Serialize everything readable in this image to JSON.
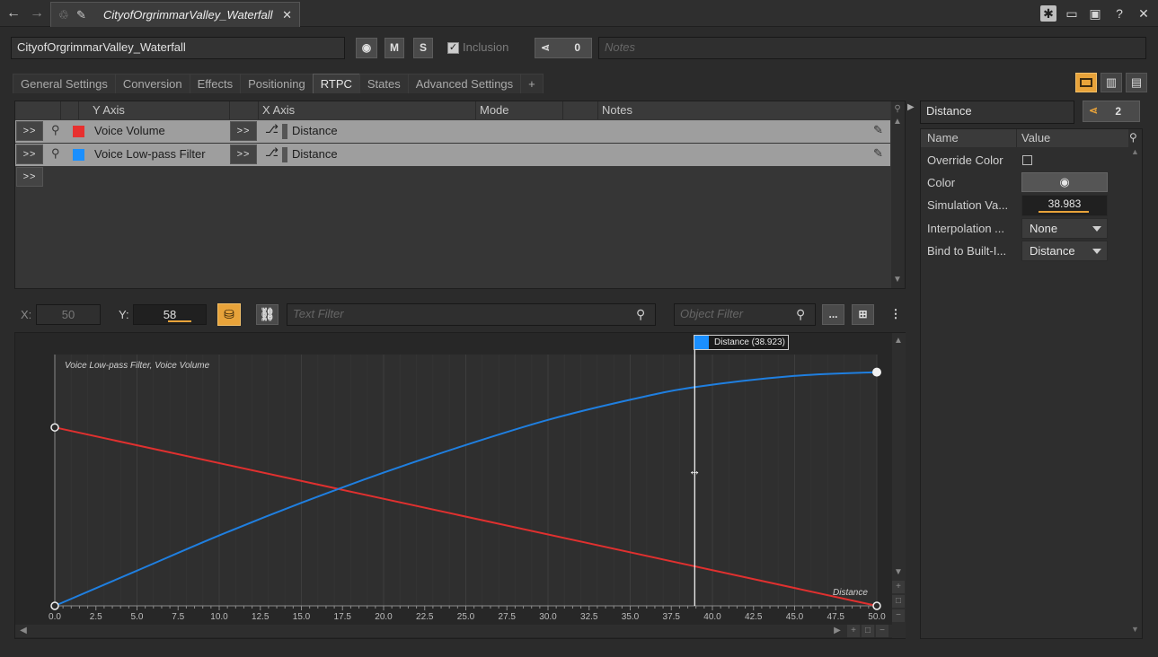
{
  "window": {
    "tab_title": "CityofOrgrimmarValley_Waterfall"
  },
  "toolbar": {
    "object_name": "CityofOrgrimmarValley_Waterfall",
    "m_label": "M",
    "s_label": "S",
    "inclusion_label": "Inclusion",
    "share_count": "0",
    "notes_placeholder": "Notes"
  },
  "tabs": [
    "General Settings",
    "Conversion",
    "Effects",
    "Positioning",
    "RTPC",
    "States",
    "Advanced Settings",
    "+"
  ],
  "rtpc_table": {
    "headers": {
      "y_axis": "Y Axis",
      "x_axis": "X Axis",
      "mode": "Mode",
      "notes": "Notes"
    },
    "expand_label": ">>",
    "rows": [
      {
        "y": "Voice Volume",
        "color": "#e8302f",
        "x": "Distance"
      },
      {
        "y": "Voice Low-pass Filter",
        "color": "#1a8fff",
        "x": "Distance"
      }
    ]
  },
  "graph_toolbar": {
    "x_label": "X:",
    "x_value": "50",
    "y_label": "Y:",
    "y_value": "58",
    "text_filter_placeholder": "Text Filter",
    "object_filter_placeholder": "Object Filter",
    "more_label": "..."
  },
  "chart_data": {
    "type": "line",
    "title": "Voice Low-pass Filter, Voice Volume",
    "xlabel": "Distance",
    "xlim": [
      0,
      50
    ],
    "ylim": [
      0,
      100
    ],
    "x_ticks": [
      "0.0",
      "2.5",
      "5.0",
      "7.5",
      "10.0",
      "12.5",
      "15.0",
      "17.5",
      "20.0",
      "22.5",
      "25.0",
      "27.5",
      "30.0",
      "32.5",
      "35.0",
      "37.5",
      "40.0",
      "42.5",
      "45.0",
      "47.5",
      "50.0"
    ],
    "cursor": {
      "x": 38.923,
      "label": "Distance (38.923)"
    },
    "series": [
      {
        "name": "Voice Volume",
        "color": "#e0302f",
        "x": [
          0,
          50
        ],
        "y": [
          71,
          0
        ]
      },
      {
        "name": "Voice Low-pass Filter",
        "color": "#1f7fe0",
        "x": [
          0,
          5,
          10,
          15,
          20,
          25,
          30,
          35,
          38.9,
          45,
          50
        ],
        "y": [
          0,
          14,
          28,
          41,
          53,
          64,
          74,
          82,
          87,
          91.5,
          93
        ]
      }
    ]
  },
  "right_panel": {
    "rtpc_name": "Distance",
    "share_count": "2",
    "headers": {
      "name": "Name",
      "value": "Value"
    },
    "props": [
      {
        "name": "Override Color"
      },
      {
        "name": "Color"
      },
      {
        "name": "Simulation Va...",
        "value": "38.983"
      },
      {
        "name": "Interpolation ...",
        "value": "None"
      },
      {
        "name": "Bind to Built-I...",
        "value": "Distance"
      }
    ]
  },
  "colors": {
    "accent": "#e8a33a",
    "background": "#2b2b2b"
  }
}
